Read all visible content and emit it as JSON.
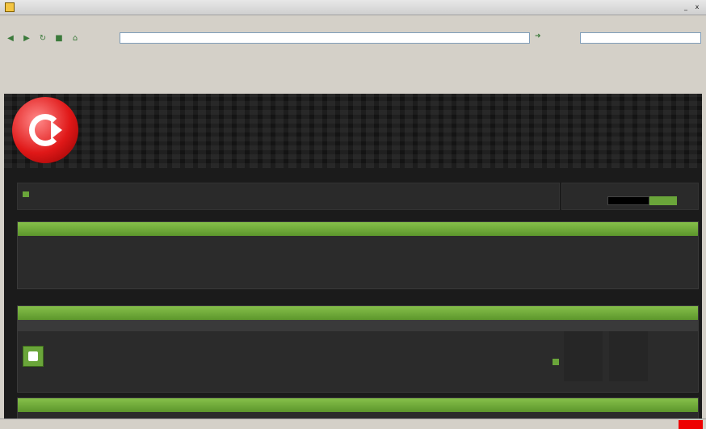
{
  "window": {
    "title": "",
    "minimize": "_",
    "close": "x"
  },
  "menu": [],
  "address": {
    "value": "",
    "placeholder": ""
  },
  "search": {
    "placeholder": ""
  },
  "links": {
    "primary": ""
  },
  "bookmarks": [],
  "tabs": [],
  "forum": {
    "breadcrumb": "",
    "login": {
      "label": "",
      "user": "",
      "input_placeholder": "",
      "button": "",
      "remember": ""
    },
    "announcement": {
      "heading": "",
      "lines": []
    },
    "category": {
      "heading": "",
      "columns": {
        "forum": "",
        "last_post": "",
        "topics": "",
        "posts": ""
      },
      "row": {
        "title": "",
        "description": "",
        "subforums": "",
        "moderators": "",
        "last_post_title": "",
        "last_post_by": "",
        "topics": "",
        "posts": ""
      }
    },
    "next_category": {
      "heading": ""
    }
  },
  "status": {
    "text": "",
    "right": ""
  },
  "colors": {
    "accent_green": "#6aa53a",
    "logo_red": "#e01818",
    "page_bg": "#1b1b1b",
    "chrome_bg": "#d4d0c8"
  },
  "icons": {
    "app": "browser-app-icon",
    "back": "back-arrow-icon",
    "forward": "forward-arrow-icon",
    "go": "go-arrow-icon",
    "forum": "forum-folder-icon",
    "logo": "site-logo-icon"
  }
}
